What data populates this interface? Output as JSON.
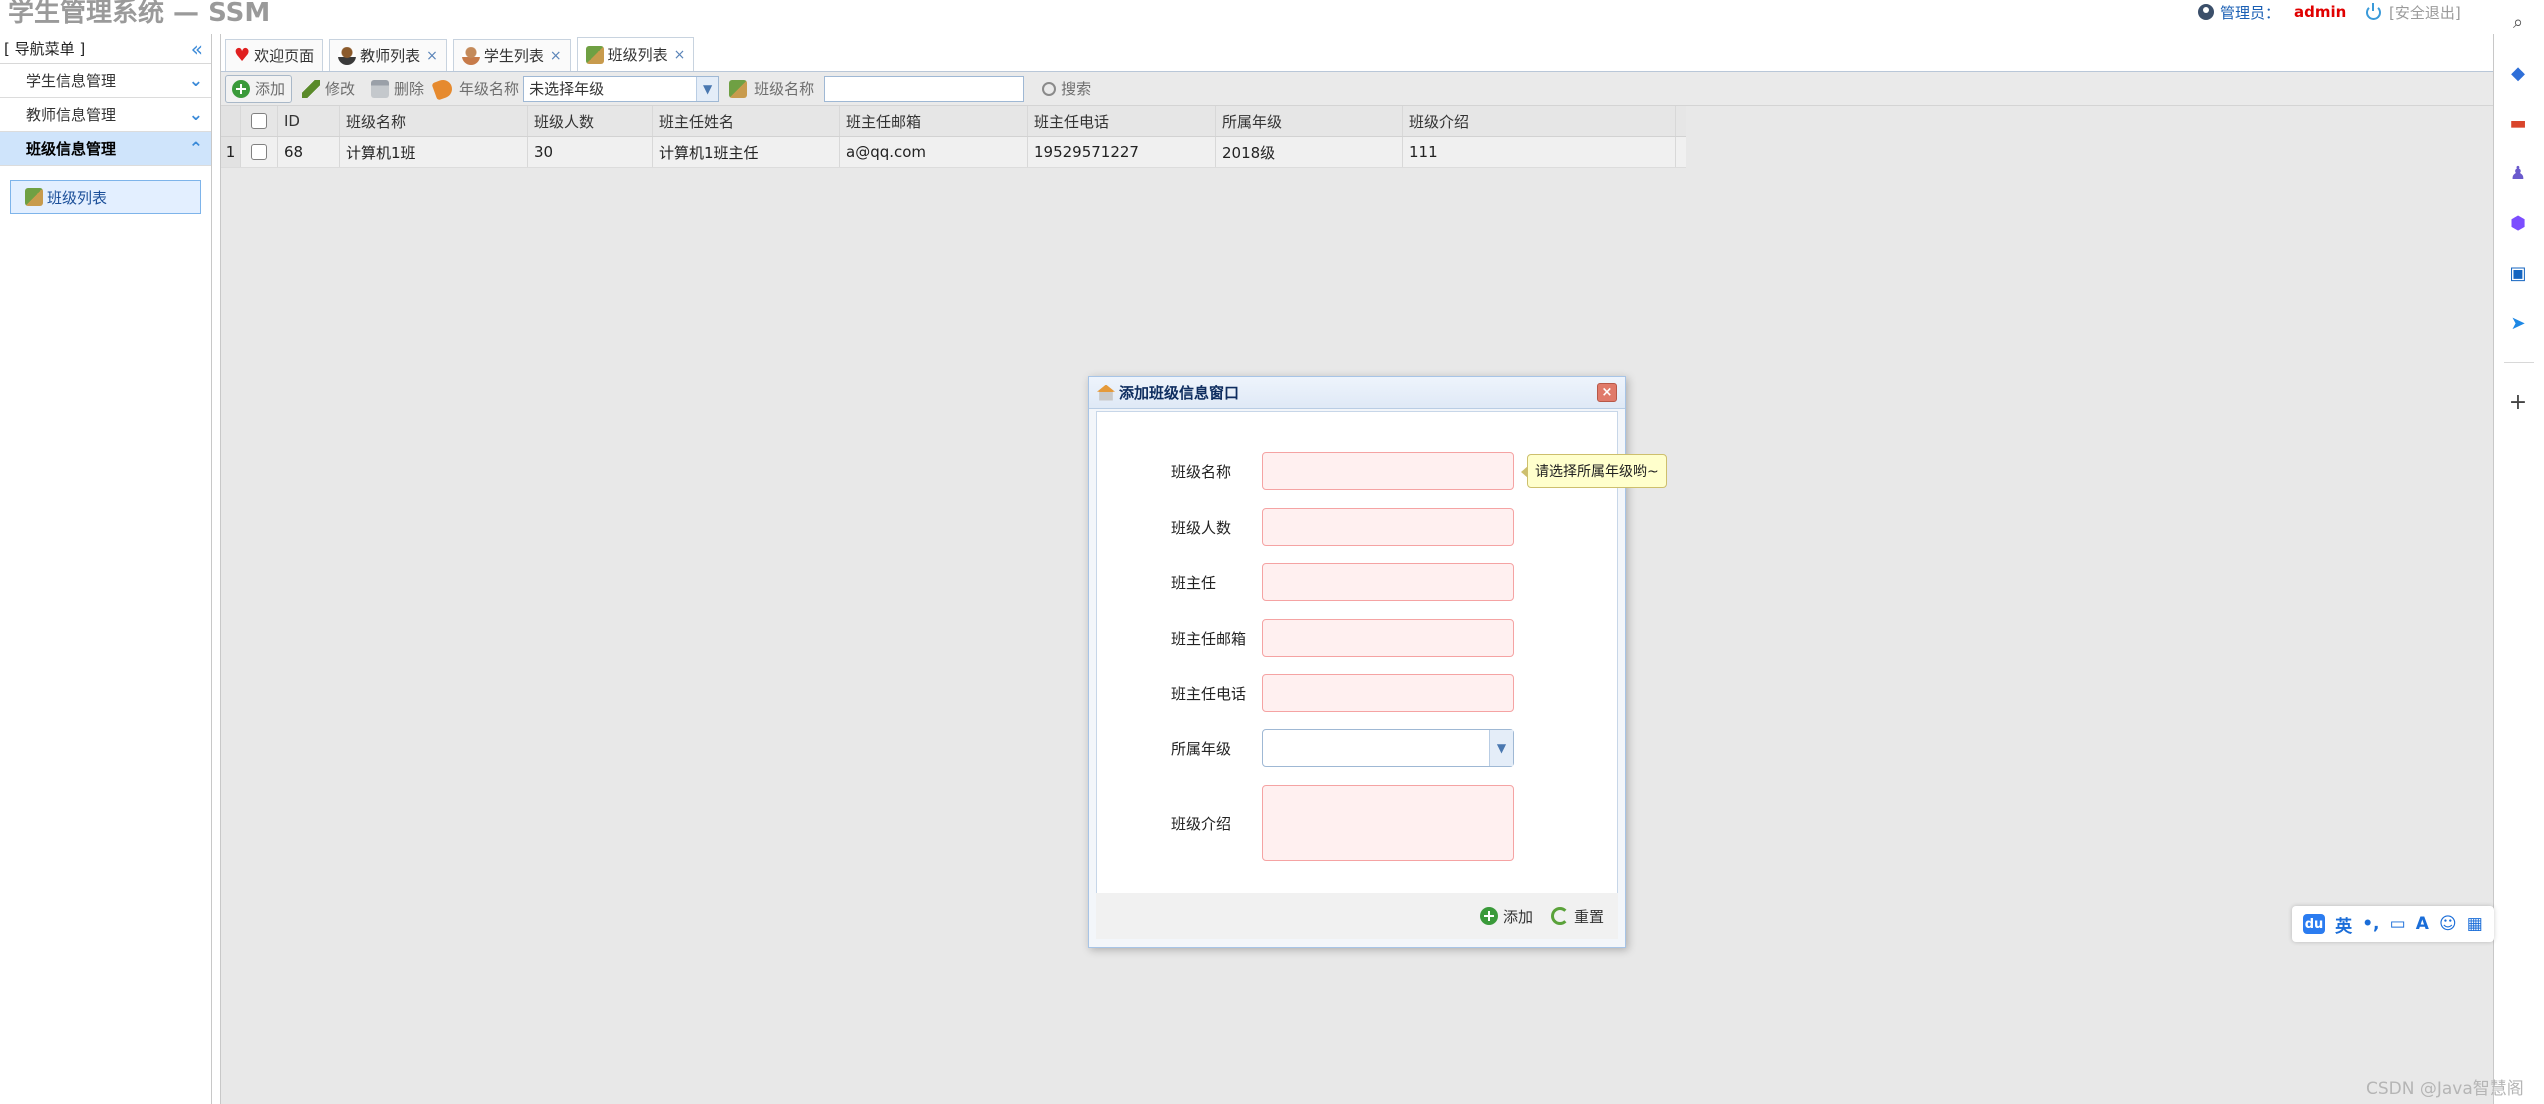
{
  "header": {
    "app_title": "学生管理系统 — SSM",
    "user_role": "管理员：",
    "user_name": "admin",
    "logout": "[安全退出]"
  },
  "sidebar": {
    "title": "[ 导航菜单 ]",
    "items": [
      {
        "label": "学生信息管理"
      },
      {
        "label": "教师信息管理"
      },
      {
        "label": "班级信息管理"
      }
    ],
    "sub_item": "班级列表"
  },
  "tabs": [
    {
      "label": "欢迎页面",
      "icon": "heart-icon"
    },
    {
      "label": "教师列表",
      "icon": "teacher-icon"
    },
    {
      "label": "学生列表",
      "icon": "student-icon"
    },
    {
      "label": "班级列表",
      "icon": "class-icon"
    }
  ],
  "toolbar": {
    "add": "添加",
    "edit": "修改",
    "delete": "删除",
    "grade_label": "年级名称",
    "grade_select": "未选择年级",
    "class_label": "班级名称",
    "search": "搜索"
  },
  "grid": {
    "columns": [
      "ID",
      "班级名称",
      "班级人数",
      "班主任姓名",
      "班主任邮箱",
      "班主任电话",
      "所属年级",
      "班级介绍"
    ],
    "rows": [
      {
        "rownum": "1",
        "cells": [
          "68",
          "计算机1班",
          "30",
          "计算机1班主任",
          "a@qq.com",
          "19529571227",
          "2018级",
          "111"
        ]
      }
    ]
  },
  "dialog": {
    "title": "添加班级信息窗口",
    "close": "×",
    "fields": [
      {
        "label": "班级名称"
      },
      {
        "label": "班级人数"
      },
      {
        "label": "班主任"
      },
      {
        "label": "班主任邮箱"
      },
      {
        "label": "班主任电话"
      },
      {
        "label": "所属年级"
      },
      {
        "label": "班级介绍"
      }
    ],
    "tooltip": "请选择所属年级哟~",
    "add_button": "添加",
    "reset_button": "重置"
  },
  "ime": {
    "lang": "英"
  },
  "watermark": "CSDN @Java智慧阁",
  "colors": {
    "accent": "#3b8ad8",
    "admin_name": "#e00000",
    "invalid_field": "#fff0f0"
  }
}
